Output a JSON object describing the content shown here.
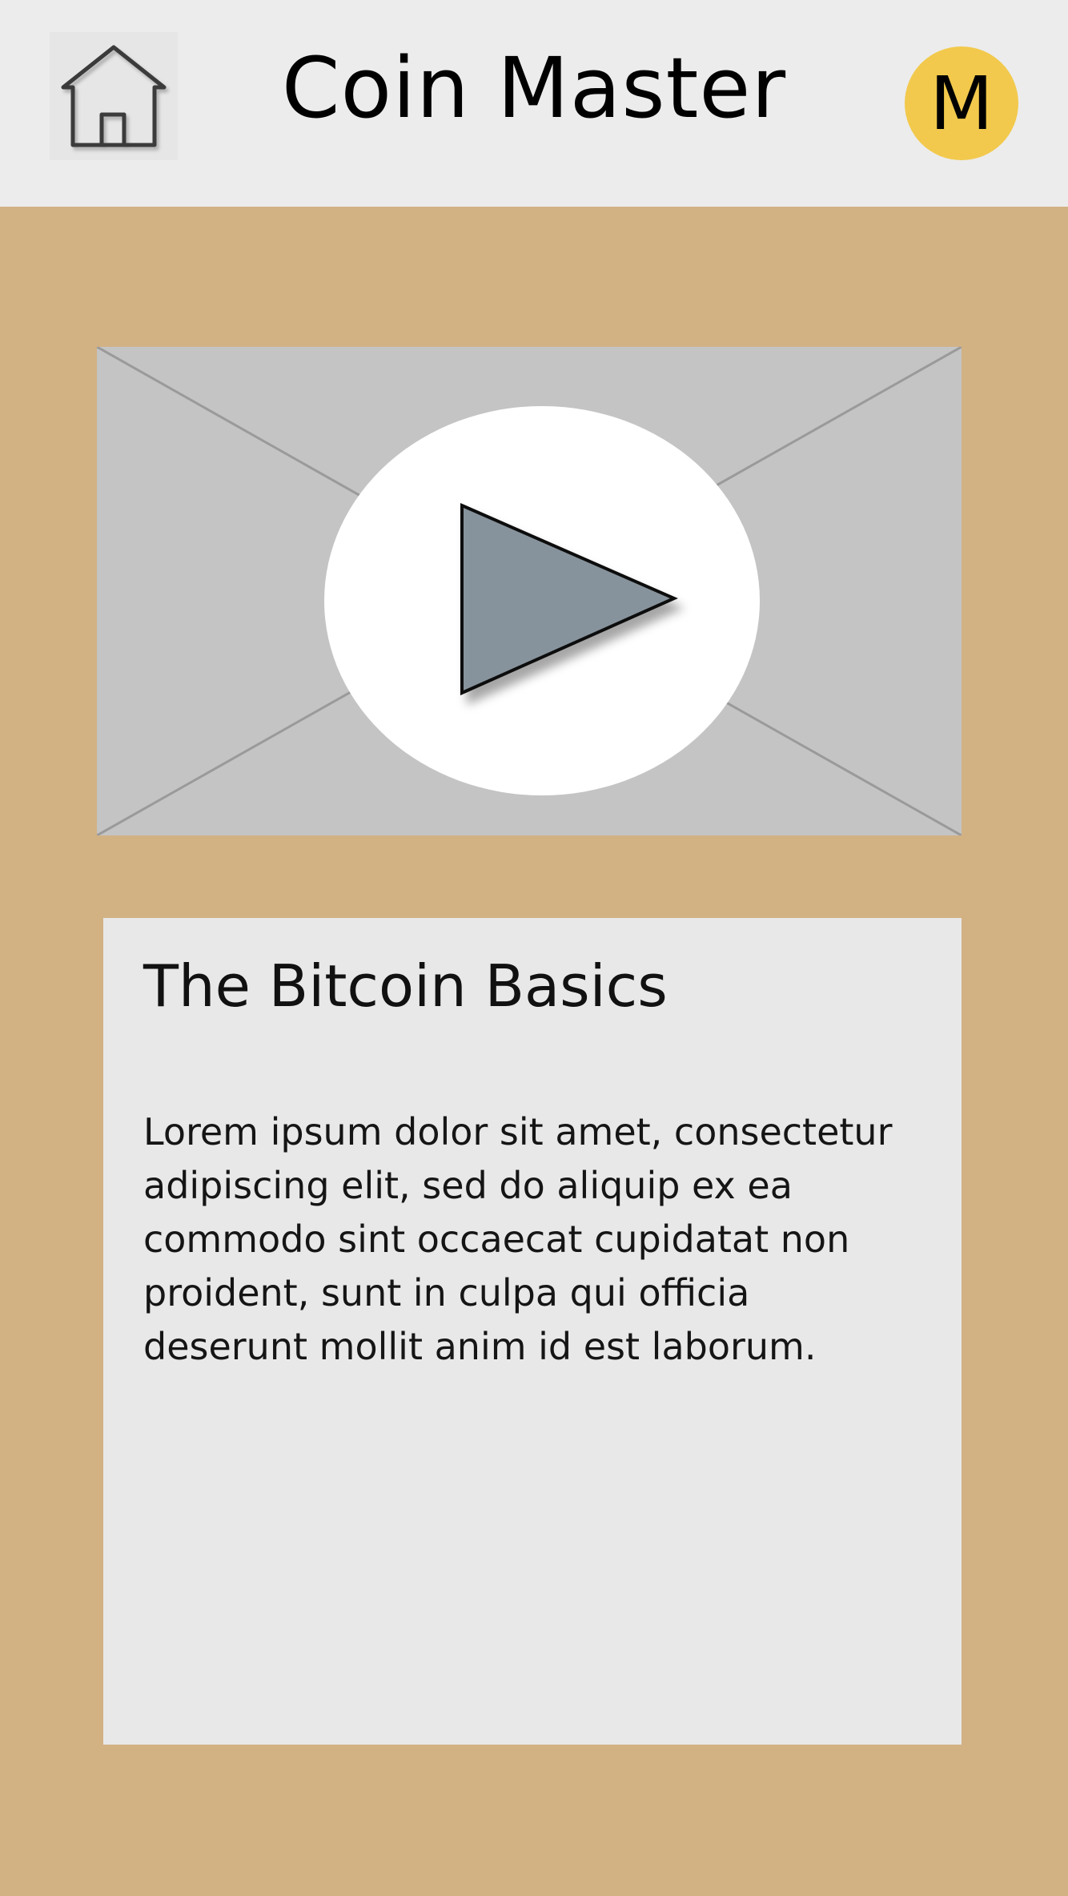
{
  "header": {
    "home_icon": "home-icon",
    "title": "Coin Master",
    "avatar_initial": "M",
    "avatar_color": "#f2c94c"
  },
  "video": {
    "play_icon": "play-icon"
  },
  "article": {
    "title": "The Bitcoin Basics",
    "body": "Lorem ipsum dolor sit amet, consectetur adipiscing elit, sed do aliquip ex ea commodo  sint occaecat cupidatat non proident, sunt in culpa qui officia deserunt mollit anim id est laborum."
  },
  "colors": {
    "background": "#d2b183",
    "header": "#ececec",
    "card": "#e8e8e8",
    "video_placeholder": "#c4c4c4",
    "play_triangle": "#87939c"
  }
}
